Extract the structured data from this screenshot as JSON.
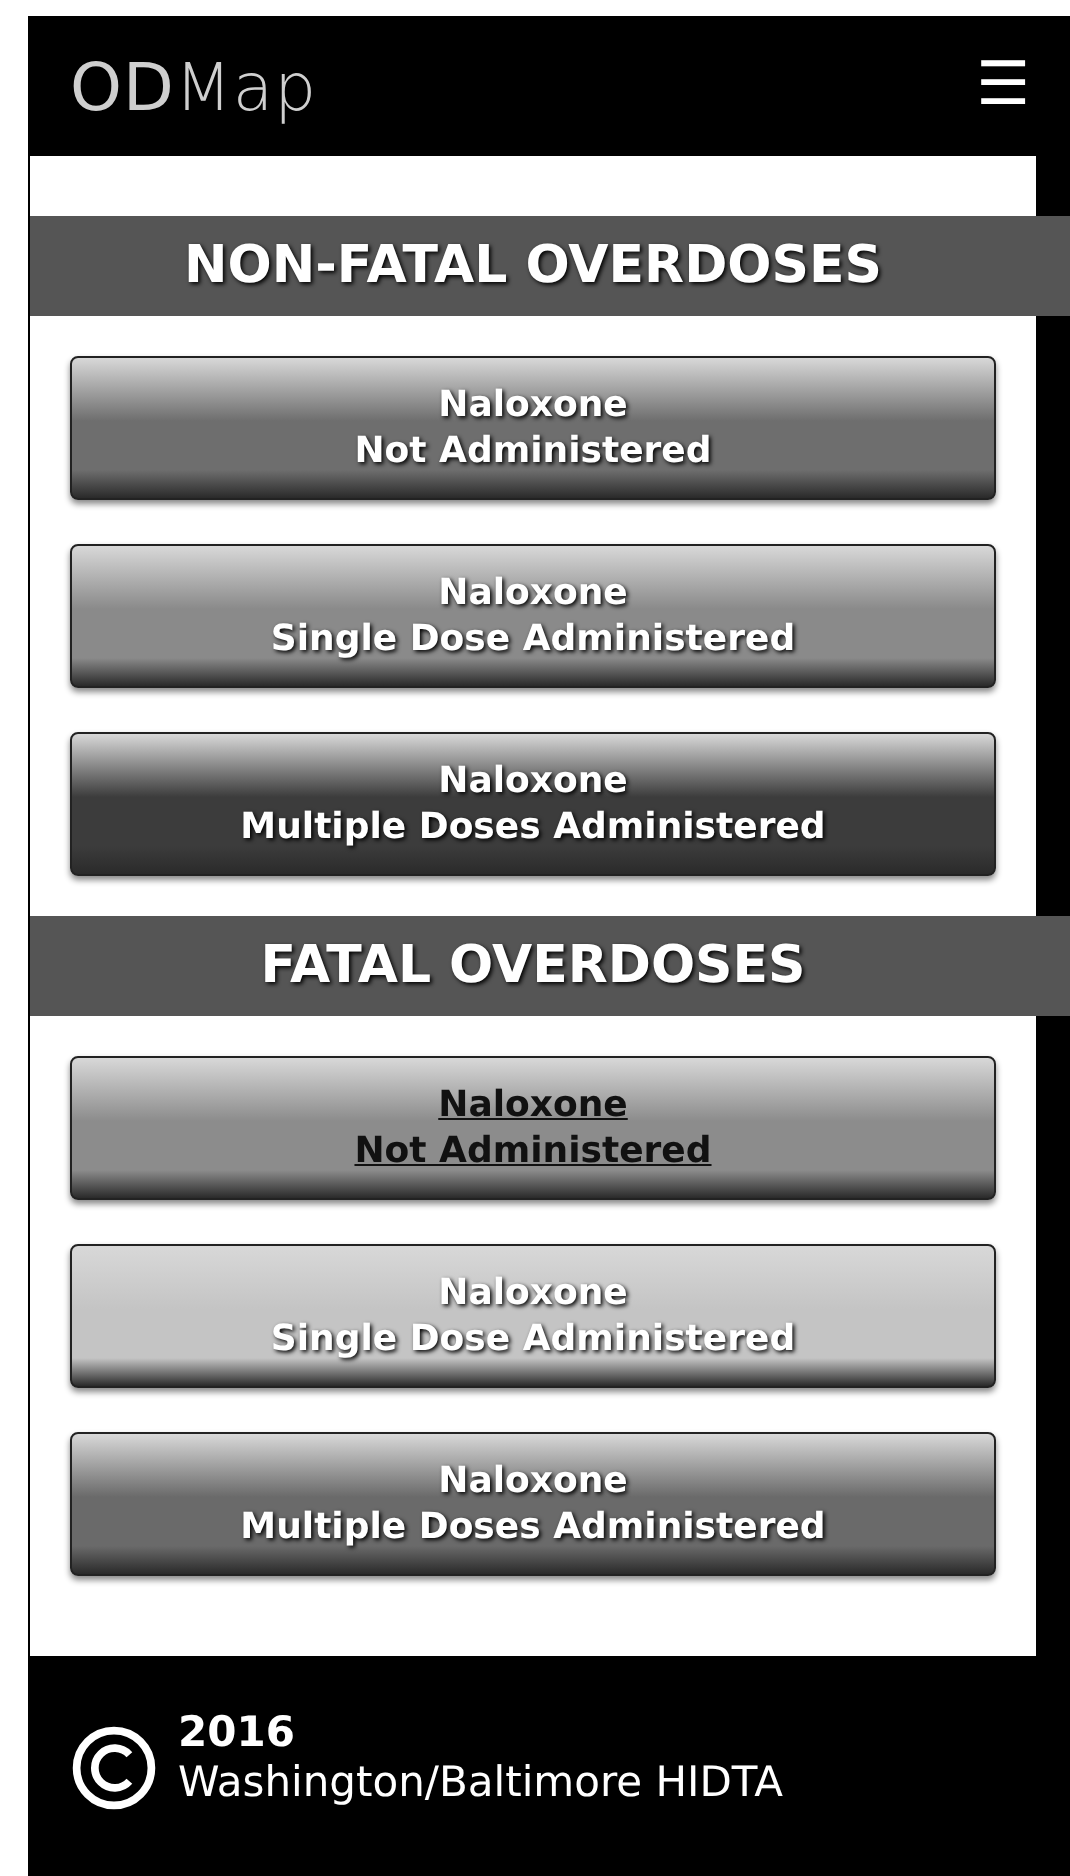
{
  "header": {
    "title": "**OD**Map",
    "menu_icon": "☰"
  },
  "sections": [
    {
      "title": "NON-FATAL OVERDOSES",
      "buttons": [
        {
          "line1": "Naloxone",
          "line2": "Not Administered",
          "color": "#6e6e6e",
          "selected": false
        },
        {
          "line1": "Naloxone",
          "line2": "Single Dose Administered",
          "color": "#8a8a8a",
          "selected": false
        },
        {
          "line1": "Naloxone",
          "line2": "Multiple Doses Administered",
          "color": "#3c3c3c",
          "selected": false
        }
      ]
    },
    {
      "title": "FATAL OVERDOSES",
      "buttons": [
        {
          "line1": "Naloxone",
          "line2": "Not Administered",
          "color": "#8c8c8c",
          "selected": true
        },
        {
          "line1": "Naloxone",
          "line2": "Single Dose Administered",
          "color": "#c4c4c4",
          "selected": false
        },
        {
          "line1": "Naloxone",
          "line2": "Multiple Doses Administered",
          "color": "#6a6a6a",
          "selected": false
        }
      ]
    }
  ],
  "footer": {
    "year": "2016",
    "org": "Washington/Baltimore HIDTA"
  }
}
